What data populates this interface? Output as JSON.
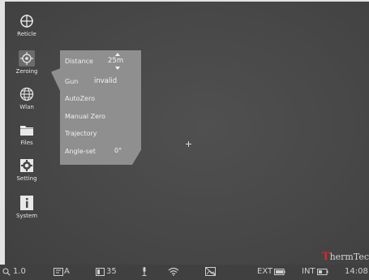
{
  "sidebar": {
    "items": [
      {
        "label": "Reticle",
        "icon": "crosshair-circle-icon"
      },
      {
        "label": "Zeroing",
        "icon": "zeroing-target-icon",
        "active": true
      },
      {
        "label": "Wlan",
        "icon": "globe-icon"
      },
      {
        "label": "Files",
        "icon": "folder-icon"
      },
      {
        "label": "Setting",
        "icon": "gear-icon"
      },
      {
        "label": "System",
        "icon": "info-icon"
      }
    ]
  },
  "zeroing_menu": {
    "distance_label": "Distance",
    "distance_value": "25m",
    "gun_label": "Gun",
    "gun_value": "invalid",
    "auto_zero": "AutoZero",
    "manual_zero": "Manual Zero",
    "trajectory": "Trajectory",
    "angle_label": "Angle-set",
    "angle_value": "0°"
  },
  "brand": {
    "first": "T",
    "rest": "hermTec"
  },
  "status": {
    "zoom": "1.0",
    "mode": "A",
    "palette_value": "35",
    "ext_label": "EXT",
    "int_label": "INT",
    "time": "14:08"
  },
  "colors": {
    "brand_accent": "#d52a2a",
    "menu_bg": "#8f8f8f"
  }
}
